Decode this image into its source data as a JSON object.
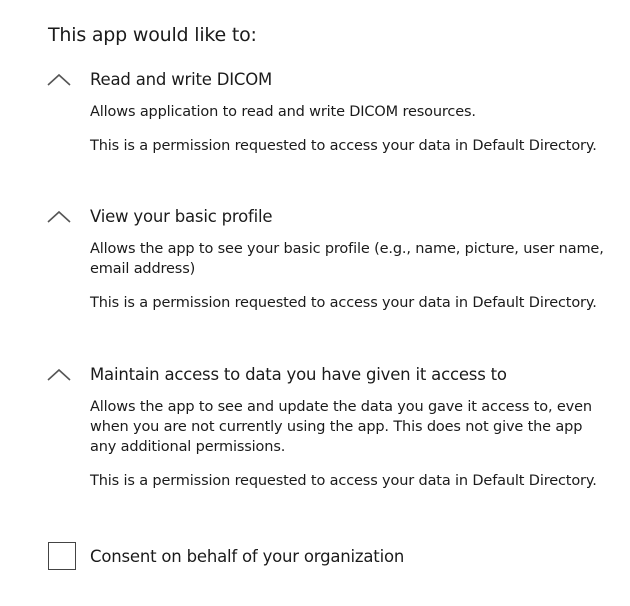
{
  "heading": "This app would like to:",
  "permissions": [
    {
      "title": "Read and write DICOM",
      "description": "Allows application to read and write DICOM resources.",
      "note": "This is a permission requested to access your data in Default Directory.",
      "expanded": true
    },
    {
      "title": "View your basic profile",
      "description": "Allows the app to see your basic profile (e.g., name, picture, user name, email address)",
      "note": "This is a permission requested to access your data in Default Directory.",
      "expanded": true
    },
    {
      "title": "Maintain access to data you have given it access to",
      "description": "Allows the app to see and update the data you gave it access to, even when you are not currently using the app. This does not give the app any additional permissions.",
      "note": "This is a permission requested to access your data in Default Directory.",
      "expanded": true
    }
  ],
  "consent": {
    "label": "Consent on behalf of your organization",
    "checked": false
  },
  "icons": {
    "chevron": "chevron-up-icon",
    "checkbox": "checkbox-unchecked-icon"
  },
  "colors": {
    "text": "#1b1b1b",
    "checkbox_border": "#444444",
    "background": "#ffffff"
  }
}
